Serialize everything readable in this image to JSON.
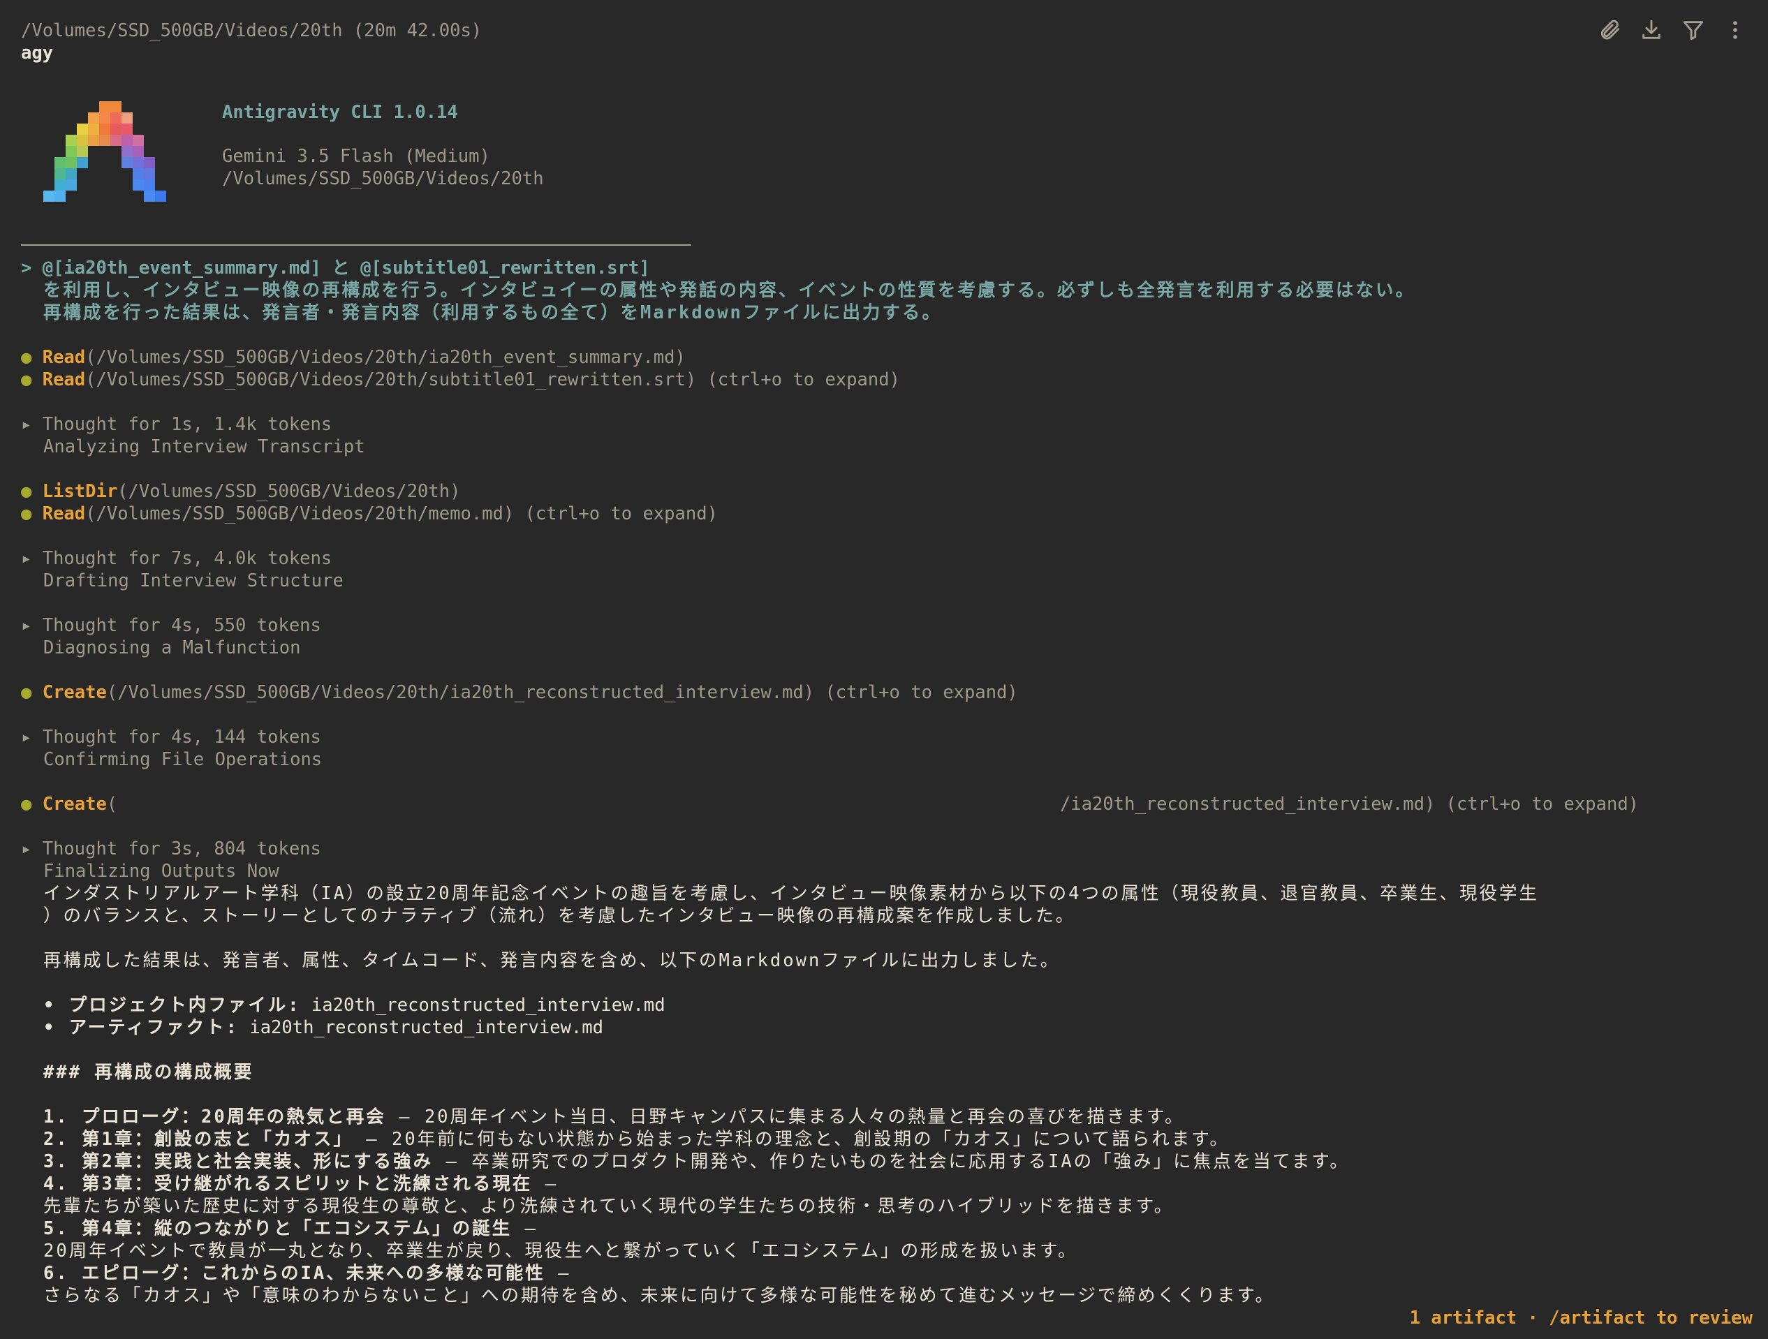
{
  "header": {
    "path": "/Volumes/SSD_500GB/Videos/20th (20m 42.00s)",
    "title": "agy"
  },
  "toolbar": {
    "icons": [
      "paperclip-icon",
      "download-icon",
      "filter-icon",
      "more-vertical-icon"
    ]
  },
  "banner": {
    "app_name": "Antigravity CLI 1.0.14",
    "model": "Gemini 3.5 Flash (Medium)",
    "cwd": "/Volumes/SSD_500GB/Videos/20th"
  },
  "prompt": {
    "marker": ">",
    "line1": "@[ia20th_event_summary.md] と @[subtitle01_rewritten.srt]",
    "line2": "を利用し、インタビュー映像の再構成を行う。インタビュイーの属性や発話の内容、イベントの性質を考慮する。必ずしも全発言を利用する必要はない。",
    "line3": "再構成を行った結果は、発言者・発言内容（利用するもの全て）をMarkdownファイルに出力する。"
  },
  "tools": {
    "read1": {
      "name": "Read",
      "args": "(/Volumes/SSD_500GB/Videos/20th/ia20th_event_summary.md)"
    },
    "read2": {
      "name": "Read",
      "args": "(/Volumes/SSD_500GB/Videos/20th/subtitle01_rewritten.srt) (ctrl+o to expand)"
    },
    "listdir": {
      "name": "ListDir",
      "args": "(/Volumes/SSD_500GB/Videos/20th)"
    },
    "read3": {
      "name": "Read",
      "args": "(/Volumes/SSD_500GB/Videos/20th/memo.md) (ctrl+o to expand)"
    },
    "create1": {
      "name": "Create",
      "args": "(/Volumes/SSD_500GB/Videos/20th/ia20th_reconstructed_interview.md) (ctrl+o to expand)"
    },
    "create2": {
      "name": "Create",
      "args_open": "(",
      "args_rest": "/ia20th_reconstructed_interview.md) (ctrl+o to expand)"
    }
  },
  "thoughts": [
    {
      "summary": "Thought for 1s, 1.4k tokens",
      "title": "Analyzing Interview Transcript"
    },
    {
      "summary": "Thought for 7s, 4.0k tokens",
      "title": "Drafting Interview Structure"
    },
    {
      "summary": "Thought for 4s, 550 tokens",
      "title": "Diagnosing a Malfunction"
    },
    {
      "summary": "Thought for 4s, 144 tokens",
      "title": "Confirming File Operations"
    },
    {
      "summary": "Thought for 3s, 804 tokens",
      "title": "Finalizing Outputs Now"
    }
  ],
  "response": {
    "para1_line1": "インダストリアルアート学科（IA）の設立20周年記念イベントの趣旨を考慮し、インタビュー映像素材から以下の4つの属性（現役教員、退官教員、卒業生、現役学生",
    "para1_line2": "）のバランスと、ストーリーとしてのナラティブ（流れ）を考慮したインタビュー映像の再構成案を作成しました。",
    "para2": "再構成した結果は、発言者、属性、タイムコード、発言内容を含め、以下のMarkdownファイルに出力しました。",
    "files": [
      {
        "label": "• プロジェクト内ファイル:",
        "value": " ia20th_reconstructed_interview.md"
      },
      {
        "label": "• アーティファクト:",
        "value": " ia20th_reconstructed_interview.md"
      }
    ],
    "heading": "### 再構成の構成概要",
    "items": [
      {
        "title": "1. プロローグ：20周年の熱気と再会",
        "desc": " — 20周年イベント当日、日野キャンパスに集まる人々の熱量と再会の喜びを描きます。",
        "cont": ""
      },
      {
        "title": "2. 第1章：創設の志と「カオス」",
        "desc": " — 20年前に何もない状態から始まった学科の理念と、創設期の「カオス」について語られます。",
        "cont": ""
      },
      {
        "title": "3. 第2章：実践と社会実装、形にする強み",
        "desc": " — 卒業研究でのプロダクト開発や、作りたいものを社会に応用するIAの「強み」に焦点を当てます。",
        "cont": ""
      },
      {
        "title": "4. 第3章：受け継がれるスピリットと洗練される現在",
        "desc": " —",
        "cont": "先輩たちが築いた歴史に対する現役生の尊敬と、より洗練されていく現代の学生たちの技術・思考のハイブリッドを描きます。"
      },
      {
        "title": "5. 第4章：縦のつながりと「エコシステム」の誕生",
        "desc": " —",
        "cont": "20周年イベントで教員が一丸となり、卒業生が戻り、現役生へと繋がっていく「エコシステム」の形成を扱います。"
      },
      {
        "title": "6. エピローグ：これからのIA、未来への多様な可能性",
        "desc": " —",
        "cont": "さらなる「カオス」や「意味のわからないこと」への期待を含め、未来に向けて多様な可能性を秘めて進むメッセージで締めくくります。"
      }
    ]
  },
  "status": {
    "text": "1 artifact · /artifact to review"
  },
  "colors": {
    "background": "#282828",
    "text": "#a89f92",
    "prompt": "#7aa8a6",
    "tool_name": "#e8a23a",
    "bullet": "#a8a830",
    "status": "#e8a23a"
  }
}
